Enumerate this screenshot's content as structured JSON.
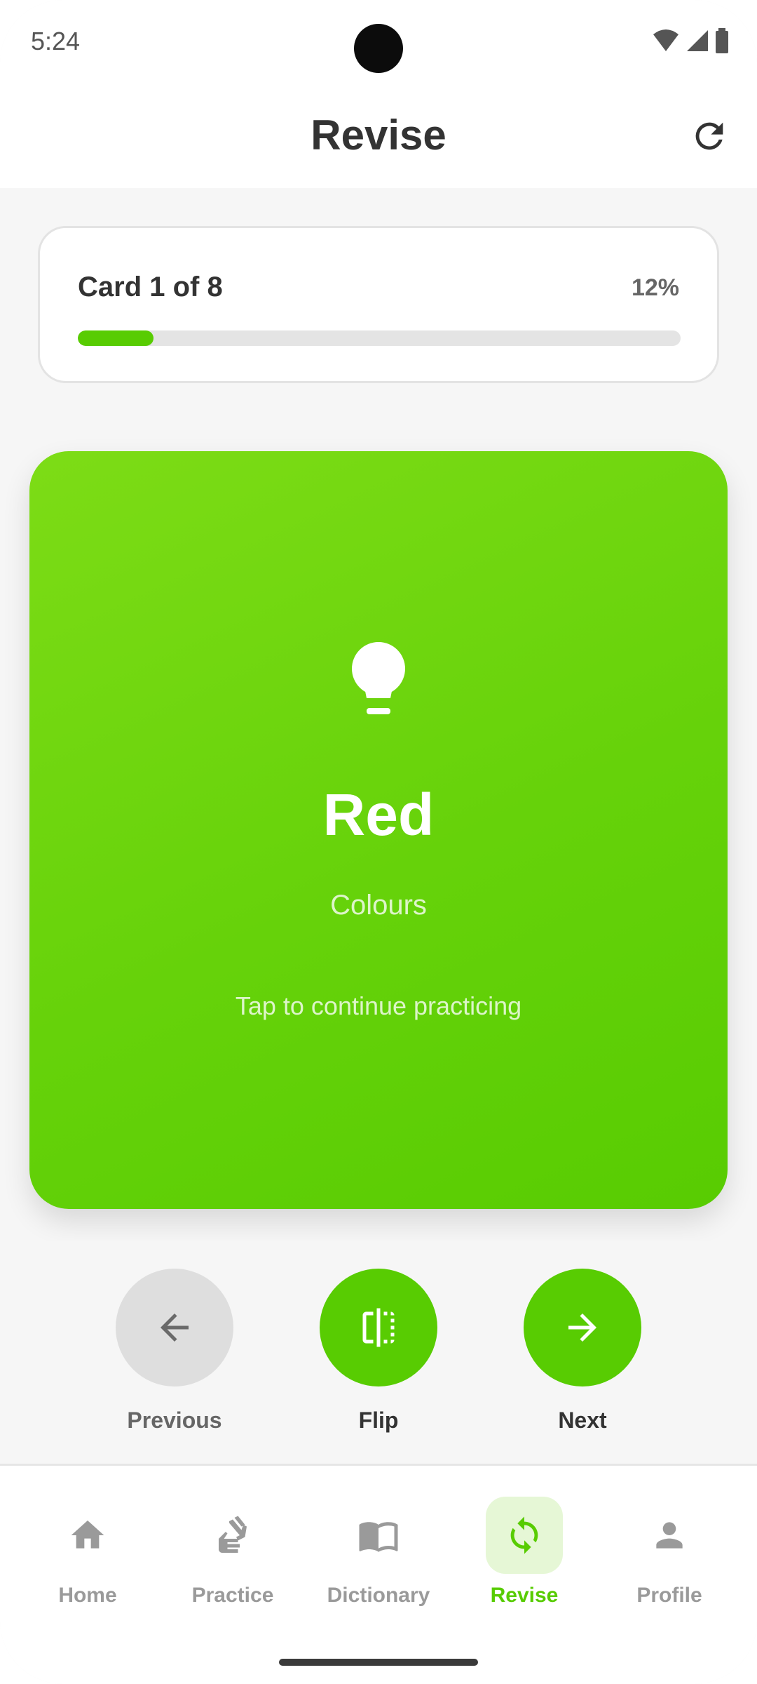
{
  "status_bar": {
    "time": "5:24"
  },
  "header": {
    "title": "Revise"
  },
  "progress": {
    "label": "Card 1 of 8",
    "percent_text": "12%",
    "fraction": 0.125
  },
  "card": {
    "word": "Red",
    "category": "Colours",
    "hint": "Tap to continue practicing"
  },
  "controls": {
    "previous": "Previous",
    "flip": "Flip",
    "next": "Next"
  },
  "nav": {
    "items": [
      {
        "label": "Home",
        "icon": "home-icon"
      },
      {
        "label": "Practice",
        "icon": "sign-hand-icon"
      },
      {
        "label": "Dictionary",
        "icon": "book-icon"
      },
      {
        "label": "Revise",
        "icon": "sync-icon"
      },
      {
        "label": "Profile",
        "icon": "person-icon"
      }
    ],
    "active": "Revise"
  },
  "colors": {
    "accent": "#58cc02",
    "accent_light": "#e6f7d6"
  }
}
